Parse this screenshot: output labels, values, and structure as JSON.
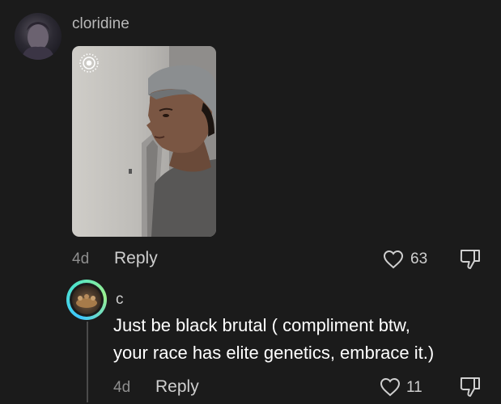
{
  "comment": {
    "username": "cloridine",
    "time": "4d",
    "reply_label": "Reply",
    "like_count": "63"
  },
  "reply": {
    "username": "c",
    "text_line1": "Just be black brutal ( compliment btw,",
    "text_line2": "your race has elite genetics, embrace it.)",
    "time": "4d",
    "reply_label": "Reply",
    "like_count": "11"
  },
  "icons": {
    "live": "live-photo-icon",
    "like": "heart-icon",
    "dislike": "thumbs-down-icon"
  },
  "colors": {
    "background": "#1b1b1b",
    "muted_text": "#8e8e8e",
    "reply_ring": "#3ec7ff"
  }
}
